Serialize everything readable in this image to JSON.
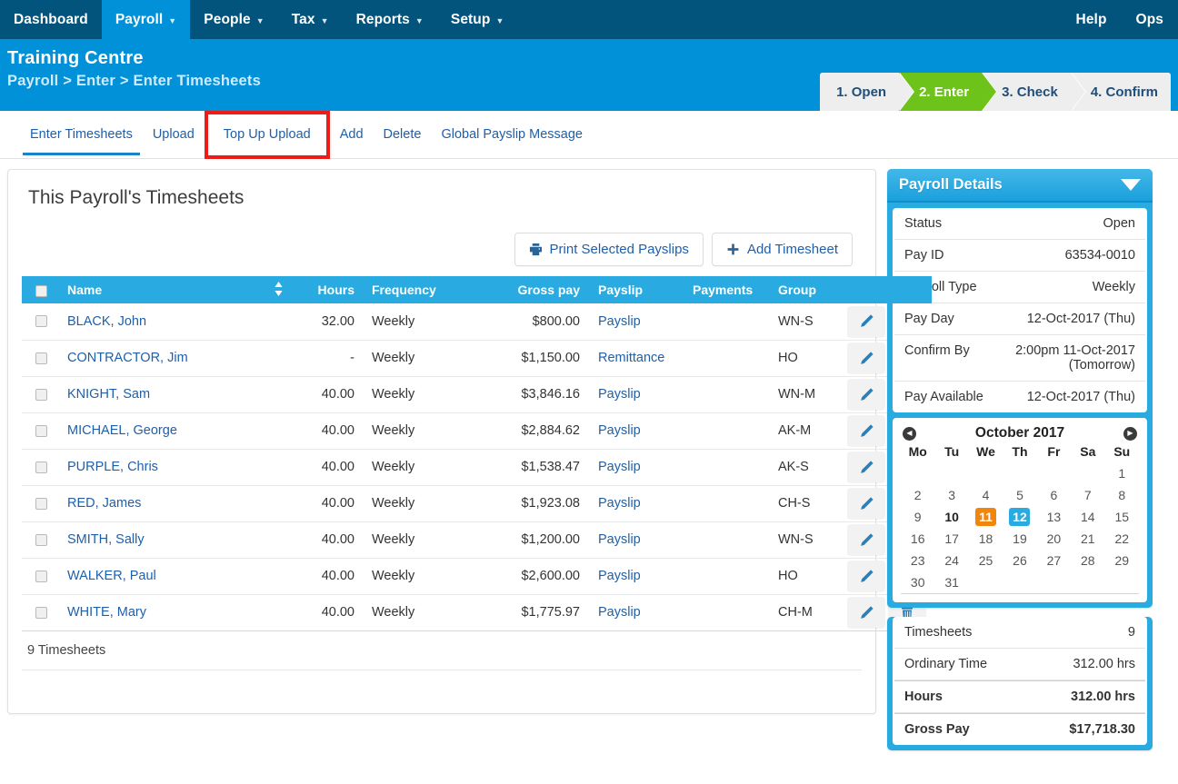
{
  "navbar": {
    "items": [
      {
        "label": "Dashboard",
        "caret": false,
        "active": false
      },
      {
        "label": "Payroll",
        "caret": true,
        "active": true
      },
      {
        "label": "People",
        "caret": true,
        "active": false
      },
      {
        "label": "Tax",
        "caret": true,
        "active": false
      },
      {
        "label": "Reports",
        "caret": true,
        "active": false
      },
      {
        "label": "Setup",
        "caret": true,
        "active": false
      }
    ],
    "right": [
      {
        "label": "Help"
      },
      {
        "label": "Ops"
      }
    ],
    "caret_glyph": "▼"
  },
  "header": {
    "org_title": "Training Centre",
    "breadcrumb": "Payroll > Enter > Enter Timesheets",
    "crumb_1": "Payroll",
    "crumb_sep": ">",
    "crumb_2": "Enter",
    "crumb_3": "Enter Timesheets",
    "wizard": [
      {
        "label": "1. Open",
        "active": false
      },
      {
        "label": "2. Enter",
        "active": true
      },
      {
        "label": "3. Check",
        "active": false
      },
      {
        "label": "4. Confirm",
        "active": false
      }
    ]
  },
  "subtabs": [
    {
      "label": "Enter Timesheets",
      "selected": true,
      "annotated": false
    },
    {
      "label": "Upload",
      "selected": false,
      "annotated": false
    },
    {
      "label": "Top Up Upload",
      "selected": false,
      "annotated": true
    },
    {
      "label": "Add",
      "selected": false,
      "annotated": false
    },
    {
      "label": "Delete",
      "selected": false,
      "annotated": false
    },
    {
      "label": "Global Payslip Message",
      "selected": false,
      "annotated": false
    }
  ],
  "annotation": {
    "color": "#ee1c18",
    "target": "Top Up Upload"
  },
  "main": {
    "title": "This Payroll's Timesheets",
    "buttons": [
      {
        "label": "Print Selected Payslips",
        "icon": "printer-icon"
      },
      {
        "label": "Add Timesheet",
        "icon": "plus-icon"
      }
    ],
    "table": {
      "columns": [
        "",
        "Name",
        "",
        "Hours",
        "Frequency",
        "Gross pay",
        "Payslip",
        "Payments",
        "Group",
        ""
      ],
      "header_checkbox": "select-all-checkbox",
      "sort_icon": "sort-arrows-icon",
      "rows": [
        {
          "name": "BLACK, John",
          "hours": "32.00",
          "frequency": "Weekly",
          "gross": "$800.00",
          "payslip": "Payslip",
          "payments": "",
          "group": "WN-S"
        },
        {
          "name": "CONTRACTOR, Jim",
          "hours": "-",
          "frequency": "Weekly",
          "gross": "$1,150.00",
          "payslip": "Remittance",
          "payments": "",
          "group": "HO"
        },
        {
          "name": "KNIGHT, Sam",
          "hours": "40.00",
          "frequency": "Weekly",
          "gross": "$3,846.16",
          "payslip": "Payslip",
          "payments": "",
          "group": "WN-M"
        },
        {
          "name": "MICHAEL, George",
          "hours": "40.00",
          "frequency": "Weekly",
          "gross": "$2,884.62",
          "payslip": "Payslip",
          "payments": "",
          "group": "AK-M"
        },
        {
          "name": "PURPLE, Chris",
          "hours": "40.00",
          "frequency": "Weekly",
          "gross": "$1,538.47",
          "payslip": "Payslip",
          "payments": "",
          "group": "AK-S"
        },
        {
          "name": "RED, James",
          "hours": "40.00",
          "frequency": "Weekly",
          "gross": "$1,923.08",
          "payslip": "Payslip",
          "payments": "",
          "group": "CH-S"
        },
        {
          "name": "SMITH, Sally",
          "hours": "40.00",
          "frequency": "Weekly",
          "gross": "$1,200.00",
          "payslip": "Payslip",
          "payments": "",
          "group": "WN-S"
        },
        {
          "name": "WALKER, Paul",
          "hours": "40.00",
          "frequency": "Weekly",
          "gross": "$2,600.00",
          "payslip": "Payslip",
          "payments": "",
          "group": "HO"
        },
        {
          "name": "WHITE, Mary",
          "hours": "40.00",
          "frequency": "Weekly",
          "gross": "$1,775.97",
          "payslip": "Payslip",
          "payments": "",
          "group": "CH-M"
        }
      ],
      "footer": "9 Timesheets",
      "row_actions": [
        "edit-icon",
        "delete-icon"
      ]
    }
  },
  "side": {
    "details": {
      "title": "Payroll Details",
      "collapse_icon": "caret-down-icon",
      "rows": [
        {
          "label": "Status",
          "value": "Open"
        },
        {
          "label": "Pay ID",
          "value": "63534-0010"
        },
        {
          "label": "Payroll Type",
          "value": "Weekly"
        },
        {
          "label": "Pay Day",
          "value": "12-Oct-2017 (Thu)"
        },
        {
          "label": "Confirm By",
          "value": "2:00pm 11-Oct-2017 (Tomorrow)"
        },
        {
          "label": "Pay Available",
          "value": "12-Oct-2017 (Thu)"
        }
      ]
    },
    "calendar": {
      "month": "October 2017",
      "prev_icon": "calendar-prev-icon",
      "next_icon": "calendar-next-icon",
      "weekdays": [
        "Mo",
        "Tu",
        "We",
        "Th",
        "Fr",
        "Sa",
        "Su"
      ],
      "weeks": [
        [
          null,
          null,
          null,
          null,
          null,
          null,
          {
            "d": "1"
          }
        ],
        [
          {
            "d": "2"
          },
          {
            "d": "3"
          },
          {
            "d": "4"
          },
          {
            "d": "5"
          },
          {
            "d": "6"
          },
          {
            "d": "7"
          },
          {
            "d": "8"
          }
        ],
        [
          {
            "d": "9"
          },
          {
            "d": "10",
            "state": "today"
          },
          {
            "d": "11",
            "state": "orange"
          },
          {
            "d": "12",
            "state": "blue"
          },
          {
            "d": "13"
          },
          {
            "d": "14"
          },
          {
            "d": "15"
          }
        ],
        [
          {
            "d": "16"
          },
          {
            "d": "17"
          },
          {
            "d": "18"
          },
          {
            "d": "19"
          },
          {
            "d": "20"
          },
          {
            "d": "21"
          },
          {
            "d": "22"
          }
        ],
        [
          {
            "d": "23"
          },
          {
            "d": "24"
          },
          {
            "d": "25"
          },
          {
            "d": "26"
          },
          {
            "d": "27"
          },
          {
            "d": "28"
          },
          {
            "d": "29"
          }
        ],
        [
          {
            "d": "30"
          },
          {
            "d": "31"
          },
          null,
          null,
          null,
          null,
          null
        ]
      ],
      "colors": {
        "orange": "#f2860d",
        "blue": "#29abe2"
      }
    },
    "totals": [
      {
        "label": "Timesheets",
        "value": "9",
        "strong": false
      },
      {
        "label": "Ordinary Time",
        "value": "312.00 hrs",
        "strong": false
      },
      {
        "label": "Hours",
        "value": "312.00 hrs",
        "strong": true
      },
      {
        "label": "Gross Pay",
        "value": "$17,718.30",
        "strong": true
      }
    ]
  },
  "colors": {
    "navbar": "#03547c",
    "header_band": "#0091d9",
    "accent_blue": "#29abe2",
    "wizard_active": "#6ec31a",
    "link": "#1f5fa9",
    "annotation_red": "#ee1c18"
  }
}
